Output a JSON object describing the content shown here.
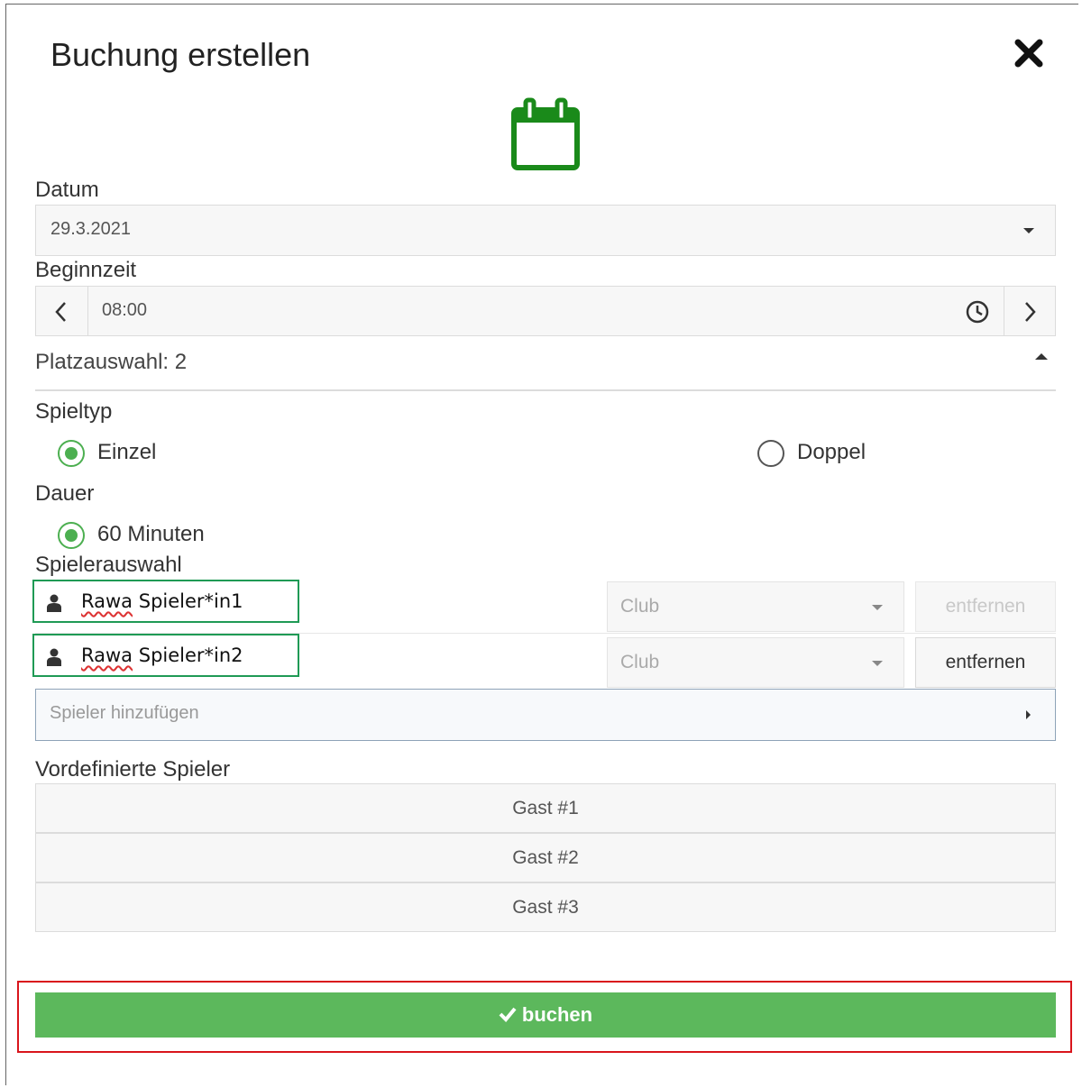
{
  "dialog": {
    "title": "Buchung erstellen"
  },
  "datum": {
    "label": "Datum",
    "value": "29.3.2021"
  },
  "beginnzeit": {
    "label": "Beginnzeit",
    "value": "08:00"
  },
  "platzauswahl": {
    "label": "Platzauswahl: 2"
  },
  "spieltyp": {
    "label": "Spieltyp",
    "options": [
      {
        "label": "Einzel",
        "selected": true
      },
      {
        "label": "Doppel",
        "selected": false
      }
    ]
  },
  "dauer": {
    "label": "Dauer",
    "options": [
      {
        "label": "60 Minuten",
        "selected": true
      }
    ]
  },
  "spielerauswahl": {
    "label": "Spielerauswahl",
    "players": [
      {
        "first": "Rawa",
        "last": "Spieler*in1",
        "club_placeholder": "Club",
        "remove_label": "entfernen",
        "remove_enabled": false
      },
      {
        "first": "Rawa",
        "last": "Spieler*in2",
        "club_placeholder": "Club",
        "remove_label": "entfernen",
        "remove_enabled": true
      }
    ],
    "add_placeholder": "Spieler hinzufügen"
  },
  "vordefiniert": {
    "label": "Vordefinierte Spieler",
    "items": [
      "Gast #1",
      "Gast #2",
      "Gast #3"
    ]
  },
  "submit": {
    "label": "buchen"
  },
  "colors": {
    "accent_green": "#5cb85c",
    "radio_green": "#4caf50",
    "icon_green": "#1a8a1a",
    "highlight_red": "#d9151c",
    "highlight_green": "#1f9a55"
  }
}
